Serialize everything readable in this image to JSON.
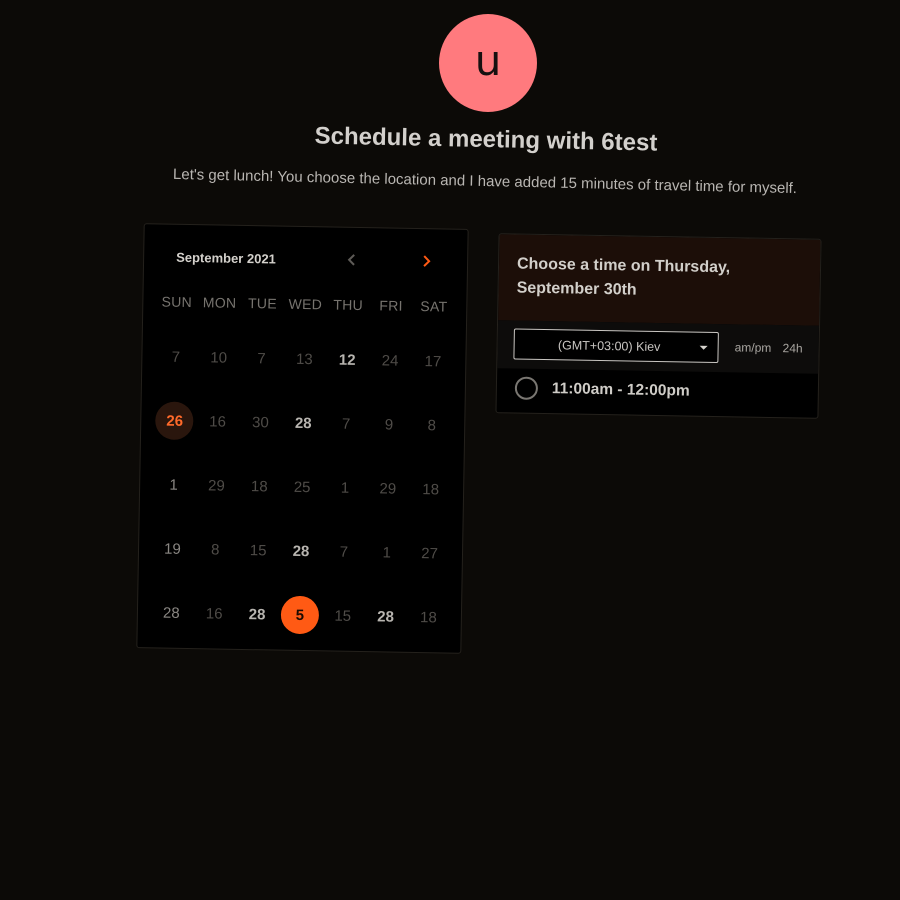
{
  "host": {
    "avatar_letter": "u"
  },
  "heading": {
    "title": "Schedule a meeting with 6test",
    "subtitle": "Let's get lunch! You choose the location and I have added 15 minutes of travel time for myself."
  },
  "calendar": {
    "month_label": "September 2021",
    "weekdays": [
      "SUN",
      "MON",
      "TUE",
      "WED",
      "THU",
      "FRI",
      "SAT"
    ],
    "weeks": [
      [
        "7",
        "10",
        "7",
        "13",
        "12",
        "24",
        "17"
      ],
      [
        "26",
        "16",
        "30",
        "28",
        "7",
        "9",
        "8"
      ],
      [
        "1",
        "29",
        "18",
        "25",
        "1",
        "29",
        "18"
      ],
      [
        "19",
        "8",
        "15",
        "28",
        "7",
        "1",
        "27"
      ],
      [
        "28",
        "16",
        "28",
        "5",
        "15",
        "28",
        "18"
      ]
    ],
    "today": {
      "week": 1,
      "day": 0
    },
    "selected": {
      "week": 4,
      "day": 3
    },
    "colors": {
      "accent": "#ff5a14",
      "today_text": "#ff6a2a",
      "today_bg": "#2a160d"
    }
  },
  "time_panel": {
    "header": "Choose a time on Thursday, September 30th",
    "timezone": "(GMT+03:00) Kiev",
    "format_ampm": "am/pm",
    "format_24h": "24h",
    "slots": [
      "11:00am - 12:00pm"
    ]
  }
}
